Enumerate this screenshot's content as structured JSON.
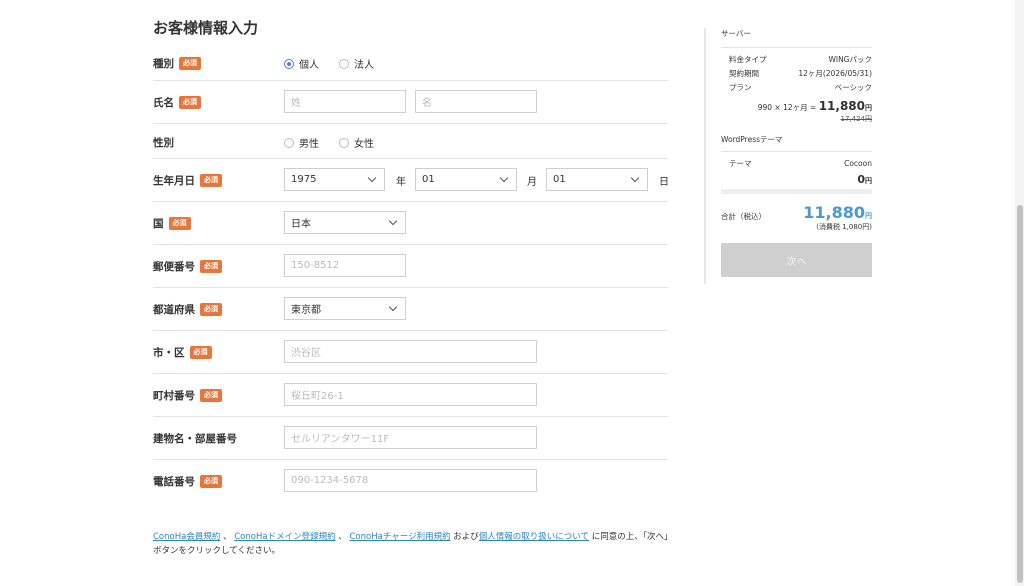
{
  "page_title": "お客様情報入力",
  "required_badge": "必須",
  "form": {
    "type": {
      "label": "種別",
      "options": [
        "個人",
        "法人"
      ],
      "selected": "個人"
    },
    "name": {
      "label": "氏名",
      "last_placeholder": "姓",
      "first_placeholder": "名"
    },
    "gender": {
      "label": "性別",
      "options": [
        "男性",
        "女性"
      ]
    },
    "birthdate": {
      "label": "生年月日",
      "year": "1975",
      "year_unit": "年",
      "month": "01",
      "month_unit": "月",
      "day": "01",
      "day_unit": "日"
    },
    "country": {
      "label": "国",
      "value": "日本"
    },
    "postal": {
      "label": "郵便番号",
      "placeholder": "150-8512"
    },
    "prefecture": {
      "label": "都道府県",
      "value": "東京都"
    },
    "city": {
      "label": "市・区",
      "placeholder": "渋谷区"
    },
    "town": {
      "label": "町村番号",
      "placeholder": "桜丘町26-1"
    },
    "building": {
      "label": "建物名・部屋番号",
      "placeholder": "セルリアンタワー11F"
    },
    "phone": {
      "label": "電話番号",
      "placeholder": "090-1234-5678"
    }
  },
  "terms": {
    "link1": "ConoHa会員規約",
    "sep1": "、",
    "link2": "ConoHaドメイン登録規約",
    "sep2": "、",
    "link3": "ConoHaチャージ利用規約",
    "mid": "および",
    "link4": "個人情報の取り扱いについて",
    "tail": "に同意の上、「次へ」ボタンをクリックしてください。"
  },
  "sidebar": {
    "server_title": "サーバー",
    "server_items": [
      {
        "label": "料金タイプ",
        "value": "WINGパック"
      },
      {
        "label": "契約期間",
        "value": "12ヶ月(2026/05/31)"
      },
      {
        "label": "プラン",
        "value": "ベーシック"
      }
    ],
    "price_formula": "990 × 12ヶ月 =",
    "price_amount": "11,880",
    "yen": "円",
    "original_price": "17,424円",
    "wp_title": "WordPressテーマ",
    "theme_label": "テーマ",
    "theme_value": "Cocoon",
    "theme_price": "0",
    "total_label": "合計（税込）",
    "total_amount": "11,880",
    "tax_note": "(消費税 1,080円)",
    "next_button": "次へ"
  }
}
